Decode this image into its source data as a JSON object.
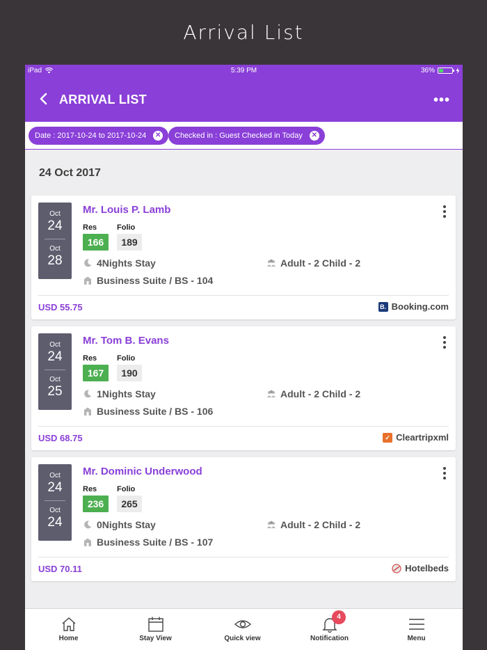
{
  "caption": "Arrival List",
  "status_bar": {
    "device": "iPad",
    "time": "5:39 PM",
    "battery": "36%",
    "battery_level": 0.36
  },
  "nav": {
    "title": "ARRIVAL LIST",
    "more": "•••"
  },
  "filters": [
    {
      "label": "Date : 2017-10-24 to 2017-10-24"
    },
    {
      "label": "Checked in : Guest Checked in Today"
    }
  ],
  "date_header": "24 Oct 2017",
  "labels": {
    "res": "Res",
    "folio": "Folio"
  },
  "cards": [
    {
      "arr_month": "Oct",
      "arr_day": "24",
      "dep_month": "Oct",
      "dep_day": "28",
      "guest": "Mr. Louis P. Lamb",
      "res": "166",
      "folio": "189",
      "stay": "4Nights Stay",
      "occupancy": "Adult - 2 Child - 2",
      "room": "Business Suite / BS - 104",
      "price": "USD 55.75",
      "source": "Booking.com",
      "source_icon": "booking-icon",
      "source_color": "#1a3a7a"
    },
    {
      "arr_month": "Oct",
      "arr_day": "24",
      "dep_month": "Oct",
      "dep_day": "25",
      "guest": "Mr. Tom B. Evans",
      "res": "167",
      "folio": "190",
      "stay": "1Nights Stay",
      "occupancy": "Adult - 2 Child - 2",
      "room": "Business Suite / BS - 106",
      "price": "USD 68.75",
      "source": "Cleartripxml",
      "source_icon": "cleartrip-icon",
      "source_color": "#e8712b"
    },
    {
      "arr_month": "Oct",
      "arr_day": "24",
      "dep_month": "Oct",
      "dep_day": "24",
      "guest": "Mr. Dominic Underwood",
      "res": "236",
      "folio": "265",
      "stay": "0Nights Stay",
      "occupancy": "Adult - 2 Child - 2",
      "room": "Business Suite / BS - 107",
      "price": "USD 70.11",
      "source": "Hotelbeds",
      "source_icon": "hotelbeds-icon",
      "source_color": "#d84a4a"
    }
  ],
  "tabs": [
    {
      "label": "Home",
      "icon": "home-icon"
    },
    {
      "label": "Stay View",
      "icon": "calendar-icon"
    },
    {
      "label": "Quick view",
      "icon": "eye-icon"
    },
    {
      "label": "Notification",
      "icon": "bell-icon",
      "badge": "4"
    },
    {
      "label": "Menu",
      "icon": "hamburger-icon"
    }
  ],
  "colors": {
    "primary": "#8a3fd8",
    "res_badge": "#4caf50",
    "notif_badge": "#e64a5c",
    "background": "#3a3539"
  }
}
